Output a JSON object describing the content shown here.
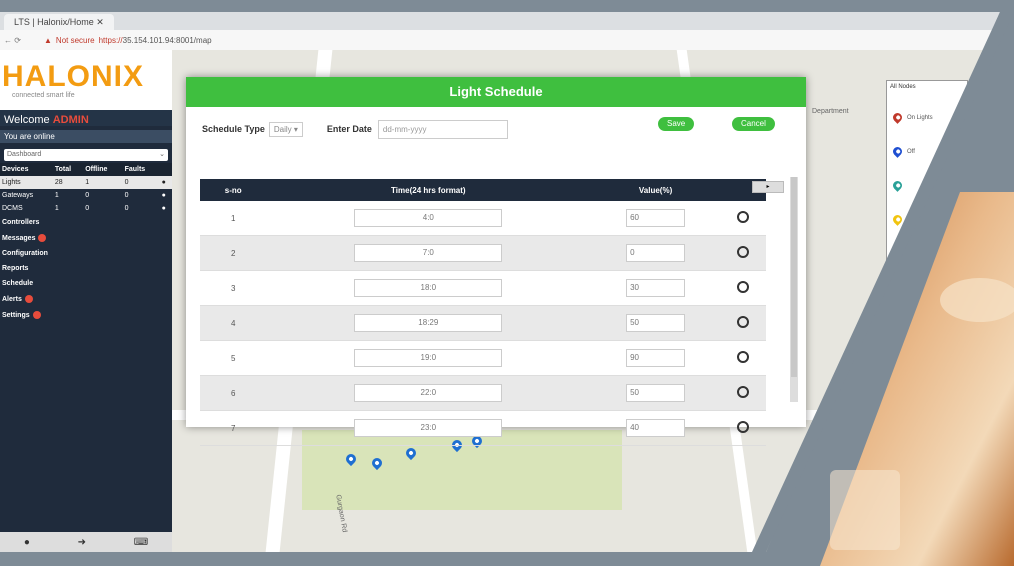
{
  "browser": {
    "tab_title": "LTS | Halonix/Home ✕",
    "security_label": "Not secure",
    "url_scheme": "https://",
    "url_host": "35.154.101.94:8001/map"
  },
  "sidebar": {
    "brand": "HALONIX",
    "brand_tagline": "connected smart life",
    "welcome_label": "Welcome",
    "user_name": "ADMIN",
    "status": "You are online",
    "dashboard_select": "Dashboard",
    "devices_table": {
      "headers": [
        "Devices",
        "Total",
        "Offline",
        "Faults"
      ],
      "rows": [
        {
          "name": "Lights",
          "total": "28",
          "offline": "1",
          "faults": "0"
        },
        {
          "name": "Gateways",
          "total": "1",
          "offline": "0",
          "faults": "0"
        },
        {
          "name": "DCMS",
          "total": "1",
          "offline": "0",
          "faults": "0"
        }
      ]
    },
    "menu": [
      {
        "label": "Controllers",
        "badge": false
      },
      {
        "label": "Messages",
        "badge": true
      },
      {
        "label": "Configuration",
        "badge": false
      },
      {
        "label": "Reports",
        "badge": false
      },
      {
        "label": "Schedule",
        "badge": false
      },
      {
        "label": "Alerts",
        "badge": true
      },
      {
        "label": "Settings",
        "badge": true
      }
    ]
  },
  "map": {
    "label_department": "Department",
    "label_road": "Gurgaon Rd",
    "legend_title": "All Nodes",
    "legend_items": [
      {
        "label": "On Lights",
        "color": "#c0392b"
      },
      {
        "label": "Off",
        "color": "#1f4fd1"
      },
      {
        "label": "",
        "color": "#2aa198"
      },
      {
        "label": "",
        "color": "#f1c40f"
      }
    ]
  },
  "modal": {
    "title": "Light Schedule",
    "schedule_type_label": "Schedule Type",
    "schedule_type_value": "Daily",
    "date_label": "Enter Date",
    "date_placeholder": "dd-mm-yyyy",
    "save_label": "Save",
    "cancel_label": "Cancel",
    "columns": [
      "s-no",
      "Time(24 hrs format)",
      "Value(%)",
      ""
    ],
    "rows": [
      {
        "sno": "1",
        "time": "4:0",
        "value": "60"
      },
      {
        "sno": "2",
        "time": "7:0",
        "value": "0"
      },
      {
        "sno": "3",
        "time": "18:0",
        "value": "30"
      },
      {
        "sno": "4",
        "time": "18:29",
        "value": "50"
      },
      {
        "sno": "5",
        "time": "19:0",
        "value": "90"
      },
      {
        "sno": "6",
        "time": "22:0",
        "value": "50"
      },
      {
        "sno": "7",
        "time": "23:0",
        "value": "40"
      }
    ]
  },
  "colors": {
    "header_green": "#3fbf3f",
    "sidebar_dark": "#1f2b3c",
    "brand_orange": "#f39c12",
    "frame_gray": "#7e8b96"
  }
}
